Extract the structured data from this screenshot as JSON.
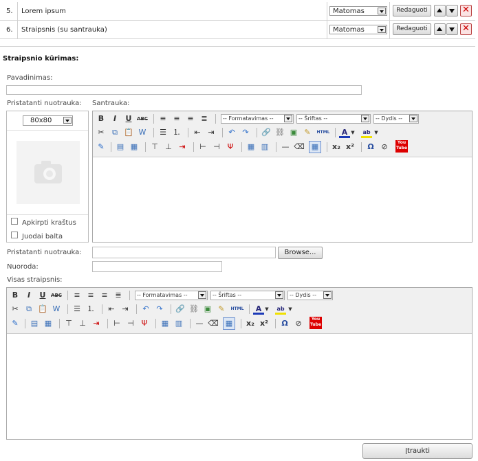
{
  "table": {
    "rows": [
      {
        "num": "5.",
        "title": "Lorem ipsum",
        "visibility": "Matomas",
        "edit_label": "Redaguoti"
      },
      {
        "num": "6.",
        "title": "Straipsnis (su santrauka)",
        "visibility": "Matomas",
        "edit_label": "Redaguoti"
      }
    ]
  },
  "form": {
    "heading": "Straipsnio kūrimas:",
    "name_label": "Pavadinimas:",
    "image_label": "Pristatanti nuotrauka:",
    "summary_label": "Santrauka:",
    "size_value": "80x80",
    "crop_label": "Apkirpti kraštus",
    "bw_label": "Juodai balta",
    "upload_label": "Pristatanti nuotrauka:",
    "browse_label": "Browse...",
    "link_label": "Nuoroda:",
    "full_label": "Visas straipsnis:",
    "submit_label": "Įtraukti"
  },
  "editor": {
    "format_label": "-- Formatavimas --",
    "font_label": "-- Šriftas --",
    "size_label": "-- Dydis --",
    "html_label": "HTML",
    "youtube_label": "You Tube"
  }
}
